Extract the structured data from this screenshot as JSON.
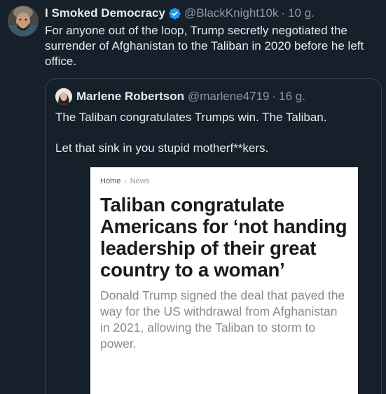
{
  "tweet": {
    "author_name": "I Smoked Democracy",
    "handle": "@BlackKnight10k",
    "separator": "·",
    "time": "10 g.",
    "text": "For anyone out of the loop, Trump secretly negotiated the surrender of Afghanistan to the Taliban in 2020 before he left office."
  },
  "quote": {
    "author_name": "Marlene Robertson",
    "handle": "@marlene4719",
    "separator": "·",
    "time": "16 g.",
    "paragraphs": [
      "The Taliban congratulates Trumps win.  The Taliban.",
      "Let that sink in you stupid motherf**kers."
    ]
  },
  "article": {
    "breadcrumb_home": "Home",
    "breadcrumb_sep": "›",
    "breadcrumb_section": "News",
    "headline": "Taliban congratulate Americans for ‘not handing leadership of their great country to a woman’",
    "subheadline": "Donald Trump signed the deal that paved the way for the US withdrawal from Afghanistan in 2021, allowing the Taliban to storm to power."
  },
  "colors": {
    "background": "#15202b",
    "text": "#e7e9ea",
    "muted": "#8b98a5",
    "verified": "#1d9bf0",
    "border": "#38444d"
  }
}
